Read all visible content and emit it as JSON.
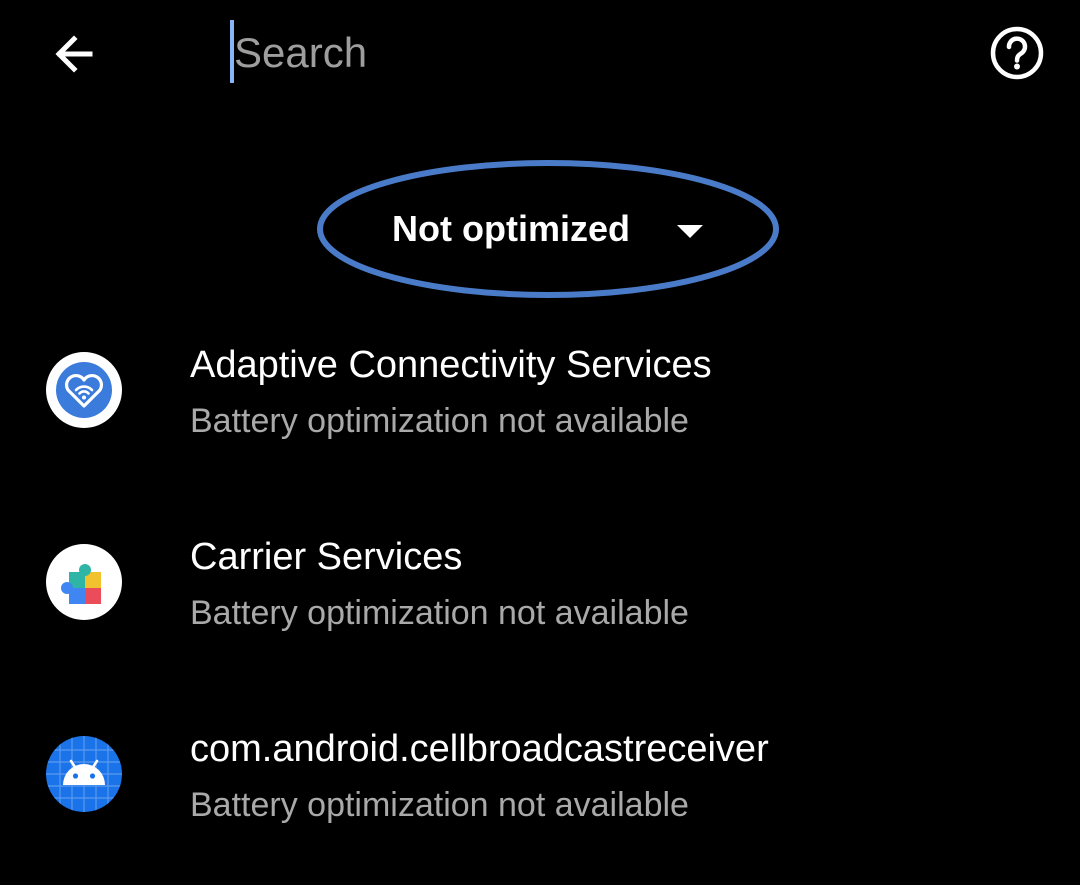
{
  "toolbar": {
    "back_icon": "arrow-back-icon",
    "search_placeholder": "Search",
    "search_value": "",
    "help_icon": "help-circle-icon"
  },
  "filter": {
    "selected": "Not optimized",
    "dropdown_icon": "dropdown-arrow-icon",
    "highlight_color": "#4a7bc8"
  },
  "apps": [
    {
      "name": "Adaptive Connectivity Services",
      "status": "Battery optimization not available",
      "icon": "heart-wifi-icon"
    },
    {
      "name": "Carrier Services",
      "status": "Battery optimization not available",
      "icon": "puzzle-piece-icon"
    },
    {
      "name": "com.android.cellbroadcastreceiver",
      "status": "Battery optimization not available",
      "icon": "android-robot-icon"
    }
  ],
  "colors": {
    "background": "#000000",
    "primary_text": "#ffffff",
    "secondary_text": "#a9a9a9",
    "accent": "#8ab4f8"
  }
}
